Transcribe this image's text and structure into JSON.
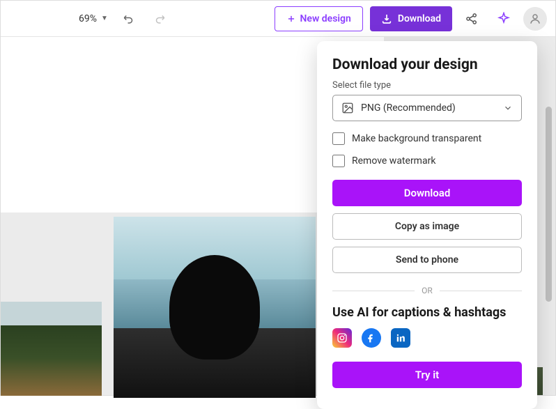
{
  "topbar": {
    "zoom": "69%",
    "new_design": "New design",
    "download": "Download"
  },
  "panel": {
    "title": "Download your design",
    "file_type_label": "Select file type",
    "file_type_value": "PNG (Recommended)",
    "transparent_label": "Make background transparent",
    "watermark_label": "Remove watermark",
    "download_btn": "Download",
    "copy_btn": "Copy as image",
    "phone_btn": "Send to phone",
    "divider": "OR",
    "ai_title": "Use AI for captions & hashtags",
    "try_btn": "Try it"
  }
}
